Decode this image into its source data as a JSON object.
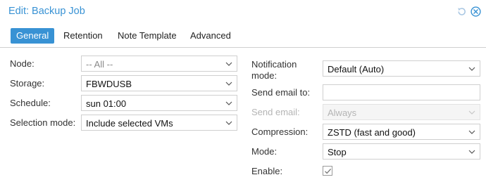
{
  "window": {
    "title": "Edit: Backup Job",
    "reset_icon": "reset-icon",
    "close_icon": "close-circle-icon"
  },
  "tabs": [
    {
      "label": "General",
      "active": true
    },
    {
      "label": "Retention",
      "active": false
    },
    {
      "label": "Note Template",
      "active": false
    },
    {
      "label": "Advanced",
      "active": false
    }
  ],
  "left_column": {
    "node": {
      "label": "Node:",
      "value": "-- All --"
    },
    "storage": {
      "label": "Storage:",
      "value": "FBWDUSB"
    },
    "schedule": {
      "label": "Schedule:",
      "value": "sun 01:00"
    },
    "selection_mode": {
      "label": "Selection mode:",
      "value": "Include selected VMs"
    }
  },
  "right_column": {
    "notification_mode": {
      "label_line1": "Notification",
      "label_line2": "mode:",
      "value": "Default (Auto)"
    },
    "send_email_to": {
      "label": "Send email to:",
      "value": ""
    },
    "send_email": {
      "label": "Send email:",
      "value": "Always",
      "disabled": true
    },
    "compression": {
      "label": "Compression:",
      "value": "ZSTD (fast and good)"
    },
    "mode": {
      "label": "Mode:",
      "value": "Stop"
    },
    "enable": {
      "label": "Enable:",
      "checked": true
    }
  },
  "colors": {
    "accent": "#3892d4",
    "border": "#cfcfcf",
    "disabled_text": "#b4b4b4"
  }
}
